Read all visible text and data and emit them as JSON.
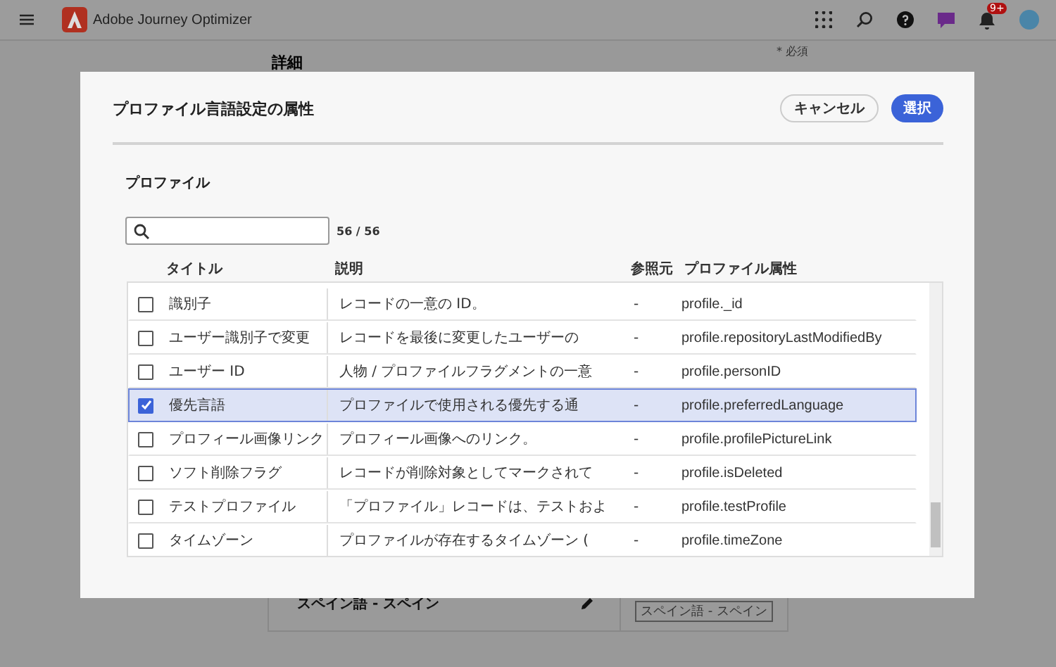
{
  "app": {
    "name": "Adobe Journey Optimizer",
    "notification_count": "9+"
  },
  "background": {
    "section_title": "詳細",
    "required_note": "* 必須",
    "language_label": "スペイン語 - スペイン",
    "language_tag": "スペイン語 - スペイン"
  },
  "dialog": {
    "title": "プロファイル言語設定の属性",
    "buttons": [
      {
        "label": "キャンセル",
        "kind": "secondary"
      },
      {
        "label": "選択",
        "kind": "primary"
      }
    ],
    "section": "プロファイル",
    "count": "56 / 56",
    "columns": [
      "タイトル",
      "説明",
      "参照元",
      "プロファイル属性"
    ],
    "rows": [
      {
        "title": "識別子",
        "description": "レコードの一意の ID。",
        "source": "-",
        "attribute": "profile._id",
        "selected": false
      },
      {
        "title": "ユーザー識別子で変更",
        "description": "レコードを最後に変更したユーザーの",
        "source": "-",
        "attribute": "profile.repositoryLastModifiedBy",
        "selected": false
      },
      {
        "title": "ユーザー ID",
        "description": "人物 / プロファイルフラグメントの一意",
        "source": "-",
        "attribute": "profile.personID",
        "selected": false
      },
      {
        "title": "優先言語",
        "description": "プロファイルで使用される優先する通",
        "source": "-",
        "attribute": "profile.preferredLanguage",
        "selected": true
      },
      {
        "title": "プロフィール画像リンク",
        "description": "プロフィール画像へのリンク。",
        "source": "-",
        "attribute": "profile.profilePictureLink",
        "selected": false
      },
      {
        "title": "ソフト削除フラグ",
        "description": "レコードが削除対象としてマークされて",
        "source": "-",
        "attribute": "profile.isDeleted",
        "selected": false
      },
      {
        "title": "テストプロファイル",
        "description": "「プロファイル」レコードは、テストおよ",
        "source": "-",
        "attribute": "profile.testProfile",
        "selected": false
      },
      {
        "title": "タイムゾーン",
        "description": "プロファイルが存在するタイムゾーン (",
        "source": "-",
        "attribute": "profile.timeZone",
        "selected": false
      }
    ]
  }
}
